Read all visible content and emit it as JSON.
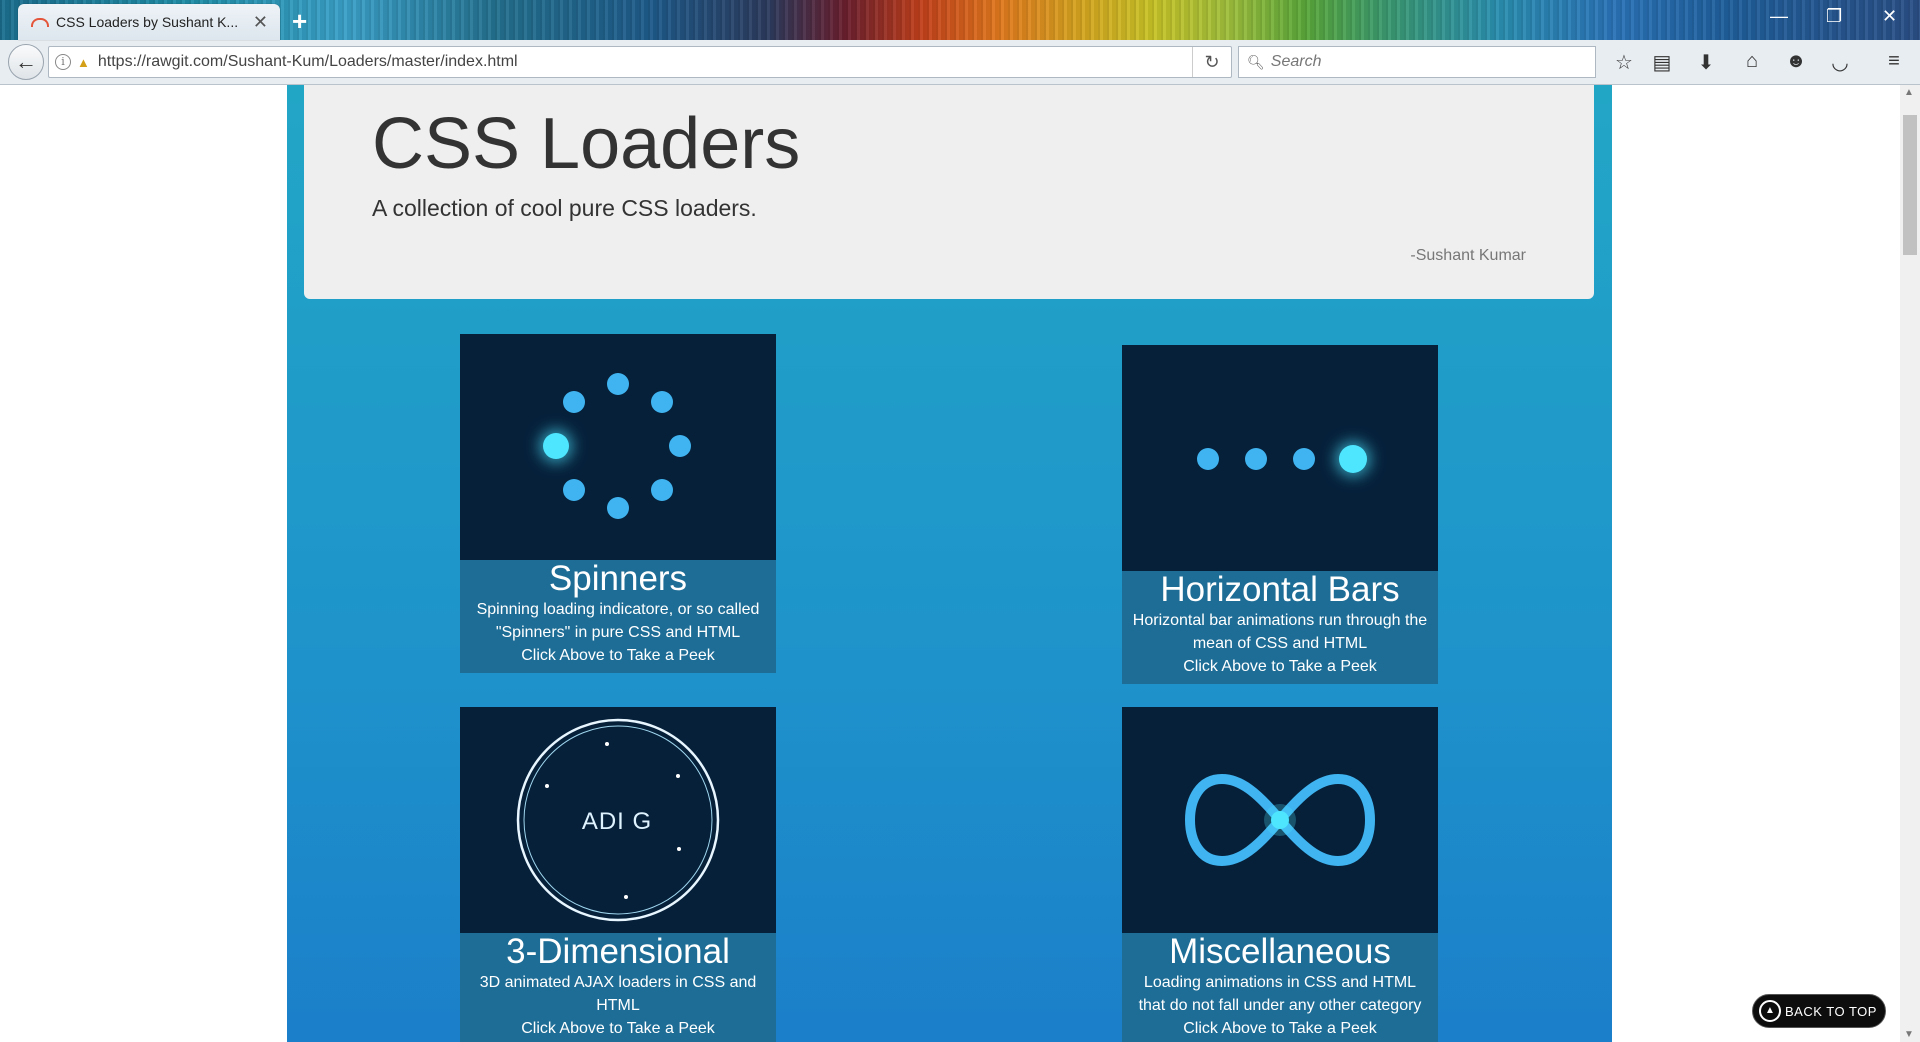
{
  "browser": {
    "tab_title": "CSS Loaders by Sushant K...",
    "url": "https://rawgit.com/Sushant-Kum/Loaders/master/index.html",
    "search_placeholder": "Search",
    "icons": [
      "back-arrow-icon",
      "site-info-icon",
      "lock-warning-icon",
      "reload-icon",
      "search-icon",
      "bookmark-star-icon",
      "reading-list-icon",
      "download-icon",
      "home-icon",
      "chat-icon",
      "pocket-icon",
      "menu-icon"
    ]
  },
  "header": {
    "title": "CSS Loaders",
    "subtitle": "A collection of cool pure CSS loaders.",
    "author": "-Sushant Kumar"
  },
  "cards": [
    {
      "title": "Spinners",
      "desc1": "Spinning loading indicatore, or so called \"Spinners\" in pure CSS and HTML",
      "cta": "Click Above to Take a Peek"
    },
    {
      "title": "Horizontal Bars",
      "desc1": "Horizontal bar animations run through the mean of CSS and HTML",
      "cta": "Click Above to Take a Peek"
    },
    {
      "title": "3-Dimensional",
      "desc1": "3D animated AJAX loaders in CSS and HTML",
      "cta": "Click Above to Take a Peek",
      "preview_text": "ADI  G"
    },
    {
      "title": "Miscellaneous",
      "desc1": "Loading animations in CSS and HTML that do not fall under any other category",
      "cta": "Click Above to Take a Peek"
    }
  ],
  "back_to_top": "BACK TO TOP",
  "colors": {
    "page_bg_top": "#22a6c6",
    "page_bg_bottom": "#1b7fc9",
    "card_image_bg": "#06203a",
    "card_caption_bg": "#1e6d96",
    "loader_accent": "#3fb4f0",
    "loader_glow": "#4ee6ff"
  }
}
